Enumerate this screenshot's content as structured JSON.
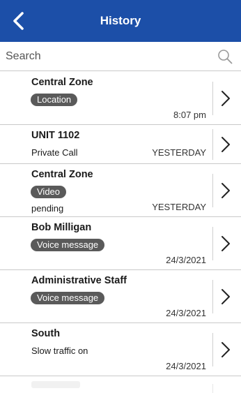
{
  "header": {
    "title": "History",
    "back_icon": "chevron-left-icon"
  },
  "search": {
    "placeholder": "Search",
    "icon": "search-icon"
  },
  "items": [
    {
      "title": "Central Zone",
      "badge": "Location",
      "time": "8:07 pm"
    },
    {
      "title": "UNIT 1102",
      "subtext": "Private Call",
      "time": "YESTERDAY"
    },
    {
      "title": "Central Zone",
      "badge": "Video",
      "status": "pending",
      "time": "YESTERDAY"
    },
    {
      "title": "Bob Milligan",
      "badge": "Voice message",
      "time": "24/3/2021"
    },
    {
      "title": "Administrative Staff",
      "badge": "Voice message",
      "time": "24/3/2021"
    },
    {
      "title": "South",
      "subtext": "Slow traffic on",
      "time": "24/3/2021"
    }
  ],
  "colors": {
    "header_bg": "#1c4fa8",
    "badge_bg": "#5a5a5a",
    "divider": "#c9c9c9"
  }
}
